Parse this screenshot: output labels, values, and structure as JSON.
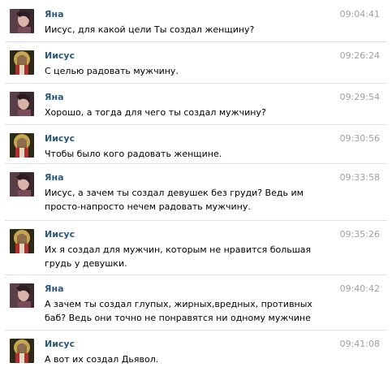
{
  "chat": {
    "colors": {
      "author": "#2b587a",
      "time": "#a0a0a0",
      "divider": "#dae1e8",
      "background": "#ffffff"
    },
    "messages": [
      {
        "author": "Яна",
        "avatar": "yana-avatar-icon",
        "time": "09:04:41",
        "text": "Иисус, для какой цели Ты создал женщину?"
      },
      {
        "author": "Иисус",
        "avatar": "jesus-avatar-icon",
        "time": "09:26:24",
        "text": "С целью радовать мужчину."
      },
      {
        "author": "Яна",
        "avatar": "yana-avatar-icon",
        "time": "09:29:54",
        "text": "Хорошо, а тогда для чего ты создал мужчину?"
      },
      {
        "author": "Иисус",
        "avatar": "jesus-avatar-icon",
        "time": "09:30:56",
        "text": "Чтобы было кого радовать женщине."
      },
      {
        "author": "Яна",
        "avatar": "yana-avatar-icon",
        "time": "09:33:58",
        "text": "Иисус, а зачем ты создал девушек без груди? Ведь им просто-напросто нечем радовать мужчину."
      },
      {
        "author": "Иисус",
        "avatar": "jesus-avatar-icon",
        "time": "09:35:26",
        "text": "Их я создал для мужчин, которым не нравится большая грудь у девушки."
      },
      {
        "author": "Яна",
        "avatar": "yana-avatar-icon",
        "time": "09:40:42",
        "text": "А зачем ты создал глупых, жирных,вредных, противных баб? Ведь они точно не понравятся ни одному мужчине"
      },
      {
        "author": "Иисус",
        "avatar": "jesus-avatar-icon",
        "time": "09:41:08",
        "text": "А вот их создал Дьявол."
      }
    ]
  }
}
